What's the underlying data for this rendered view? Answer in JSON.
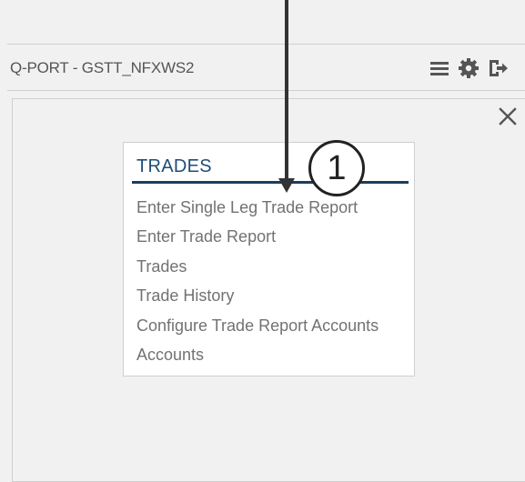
{
  "header": {
    "title": "Q-PORT - GSTT_NFXWS2",
    "icons": [
      "menu-icon",
      "gear-icon",
      "logout-icon"
    ]
  },
  "trades_card": {
    "heading": "TRADES",
    "items": [
      {
        "label": "Enter Single Leg Trade Report"
      },
      {
        "label": "Enter Trade Report"
      },
      {
        "label": "Trades"
      },
      {
        "label": "Trade History"
      },
      {
        "label": "Configure Trade Report Accounts"
      },
      {
        "label": "Accounts"
      }
    ]
  },
  "annotation": {
    "step_number": "1"
  },
  "colors": {
    "background": "#f1f1f1",
    "heading": "#1f4d78",
    "rule": "#1b3e5e",
    "link_text": "#727272",
    "title_text": "#555555"
  }
}
